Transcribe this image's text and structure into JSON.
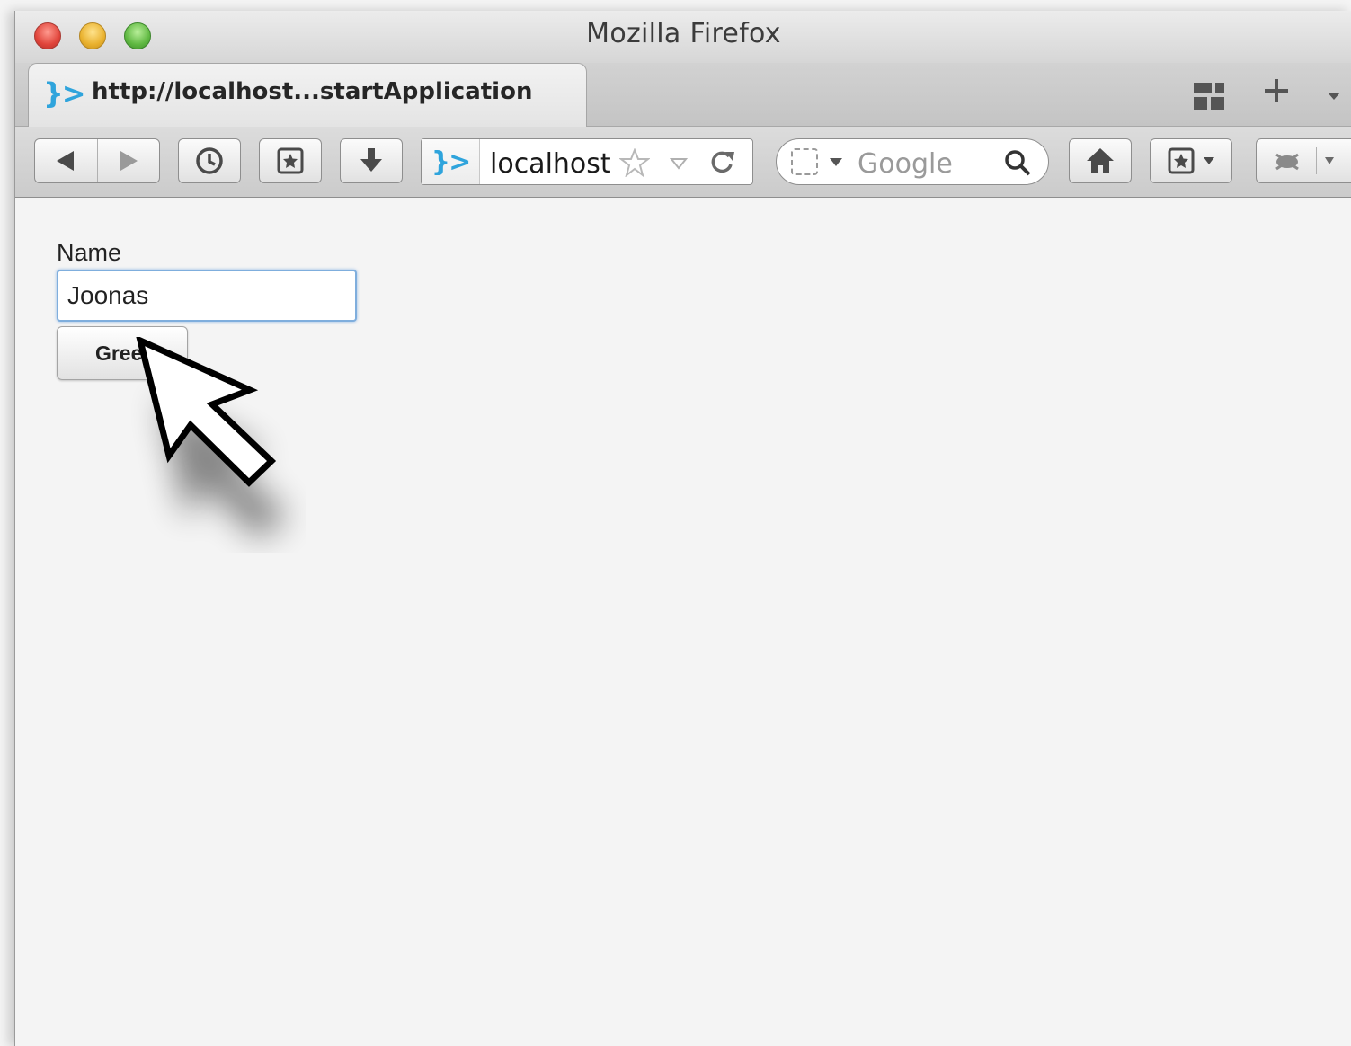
{
  "window": {
    "title": "Mozilla Firefox"
  },
  "tabs": [
    {
      "title": "http://localhost...startApplication",
      "favicon": "vaadin-icon"
    }
  ],
  "navbar": {
    "url": "localhost",
    "search_placeholder": "Google",
    "identity_icon": "vaadin-icon",
    "icons": [
      "back-icon",
      "forward-icon",
      "history-icon",
      "bookmarks-icon",
      "download-icon",
      "bookmark-star-icon",
      "reload-icon",
      "search-engine-icon",
      "search-icon",
      "home-icon",
      "bookmarks-menu-icon",
      "addon-icon"
    ]
  },
  "content": {
    "name_label": "Name",
    "name_value": "Joonas",
    "greet_label": "Greet"
  },
  "colors": {
    "accent": "#2fa4dc",
    "input_focus": "#7faedd",
    "background": "#f4f4f4"
  }
}
